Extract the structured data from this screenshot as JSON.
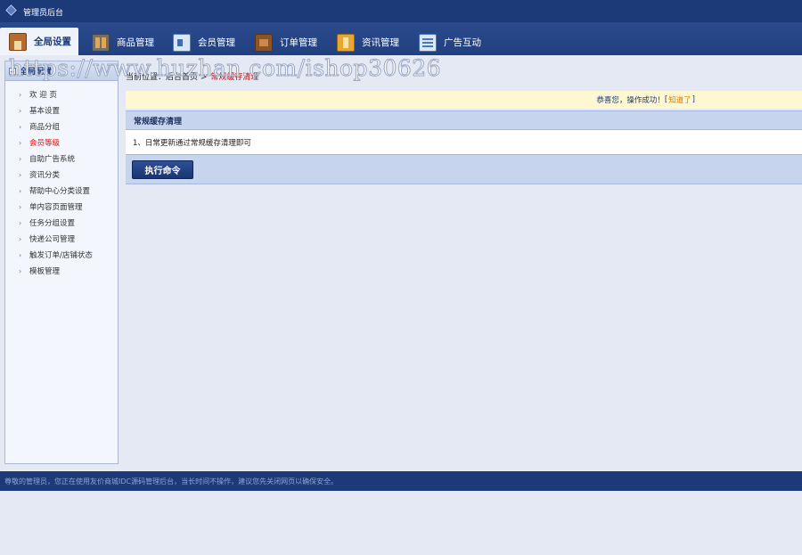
{
  "app": {
    "title": "管理员后台"
  },
  "nav": {
    "items": [
      {
        "label": "全局设置",
        "icon": "house-icon",
        "active": true
      },
      {
        "label": "商品管理",
        "icon": "goods-icon"
      },
      {
        "label": "会员管理",
        "icon": "member-card-icon"
      },
      {
        "label": "订单管理",
        "icon": "wallet-icon"
      },
      {
        "label": "资讯管理",
        "icon": "news-icon"
      },
      {
        "label": "广告互动",
        "icon": "list-icon"
      }
    ]
  },
  "watermark": "https://www.huzhan.com/ishop30626",
  "sidebar": {
    "title": "全局配置",
    "items": [
      {
        "label": "欢 迎 页"
      },
      {
        "label": "基本设置"
      },
      {
        "label": "商品分组"
      },
      {
        "label": "会员等级",
        "current": true
      },
      {
        "label": "自助广告系统"
      },
      {
        "label": "资讯分类"
      },
      {
        "label": "帮助中心分类设置"
      },
      {
        "label": "单内容页面管理"
      },
      {
        "label": "任务分组设置"
      },
      {
        "label": "快递公司管理"
      },
      {
        "label": "触发订单/店铺状态"
      },
      {
        "label": "模板管理"
      }
    ]
  },
  "breadcrumb": {
    "path": "当前位置：后台首页 >",
    "current": "常规缓存清理"
  },
  "notice": {
    "text": "恭喜您，操作成功！",
    "link_open": "[",
    "link": "知道了",
    "link_close": "]"
  },
  "panel": {
    "title": "常规缓存清理",
    "body": "1、日常更新通过常规缓存清理即可",
    "button": "执行命令"
  },
  "footer": {
    "text": "尊敬的管理员，您正在使用友价商城IDC源码管理后台，当长时间不操作，建议您先关闭网页以确保安全。"
  },
  "colors": {
    "nav_bg": "#21407f",
    "accent": "#1d3a78",
    "panel_bg": "#c6d5ed",
    "notice_bg": "#fdf7d2"
  }
}
